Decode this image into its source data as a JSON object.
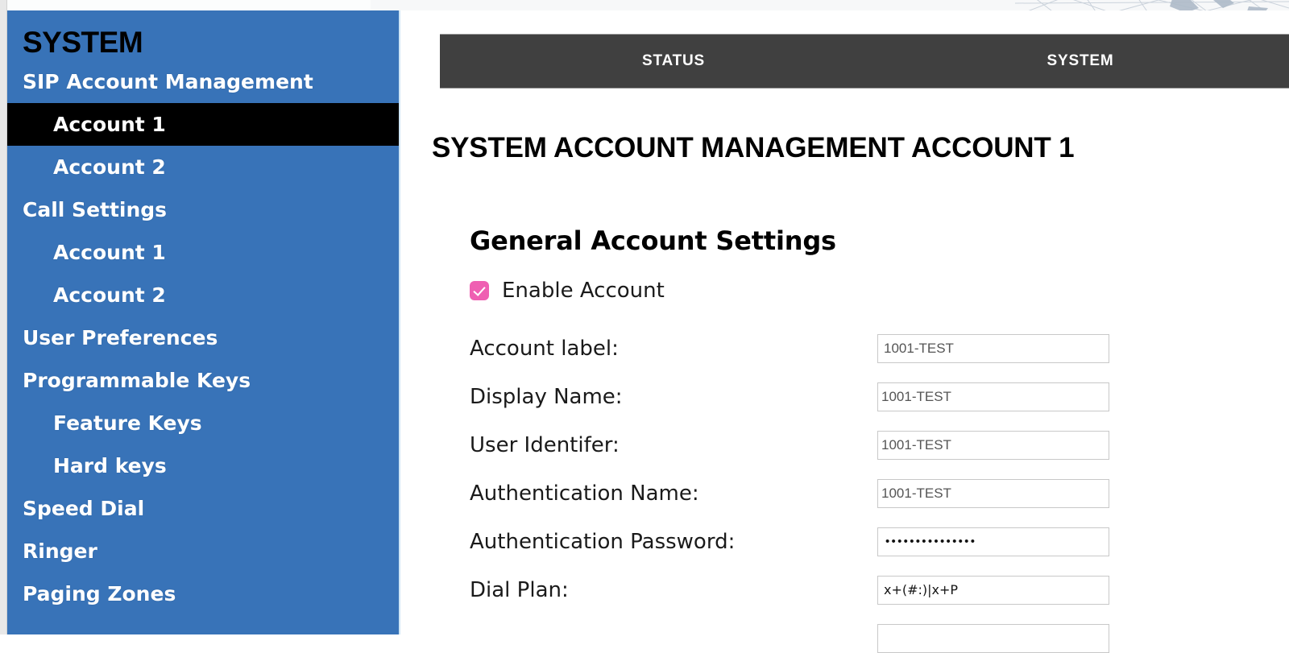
{
  "sidebar": {
    "title": "SYSTEM",
    "items": [
      {
        "label": "SIP Account Management",
        "level": "top",
        "active": false
      },
      {
        "label": "Account 1",
        "level": "sub",
        "active": true
      },
      {
        "label": "Account 2",
        "level": "sub",
        "active": false
      },
      {
        "label": "Call Settings",
        "level": "top",
        "active": false
      },
      {
        "label": "Account 1",
        "level": "sub",
        "active": false
      },
      {
        "label": "Account 2",
        "level": "sub",
        "active": false
      },
      {
        "label": "User Preferences",
        "level": "top",
        "active": false
      },
      {
        "label": "Programmable Keys",
        "level": "top",
        "active": false
      },
      {
        "label": "Feature Keys",
        "level": "sub",
        "active": false
      },
      {
        "label": "Hard keys",
        "level": "sub",
        "active": false
      },
      {
        "label": "Speed Dial",
        "level": "top",
        "active": false
      },
      {
        "label": "Ringer",
        "level": "top",
        "active": false
      },
      {
        "label": "Paging Zones",
        "level": "top",
        "active": false
      }
    ]
  },
  "tabs": [
    {
      "label": "STATUS",
      "active": false
    },
    {
      "label": "SYSTEM",
      "active": true
    }
  ],
  "main": {
    "page_title": "SYSTEM ACCOUNT MANAGEMENT ACCOUNT 1",
    "section_title": "General Account Settings",
    "enable_account": {
      "label": "Enable Account",
      "checked": true
    },
    "fields": [
      {
        "label": "Account label:",
        "value": "1001-TEST",
        "type": "text"
      },
      {
        "label": "Display Name:",
        "value": "1001-TEST",
        "type": "text"
      },
      {
        "label": "User Identifer:",
        "value": "1001-TEST",
        "type": "text"
      },
      {
        "label": "Authentication Name:",
        "value": "1001-TEST",
        "type": "text"
      },
      {
        "label": "Authentication Password:",
        "value": "•••••••••••••••",
        "type": "password"
      },
      {
        "label": "Dial Plan:",
        "value": "x+(#:)|x+P",
        "type": "text"
      },
      {
        "label": "",
        "value": "",
        "type": "text"
      }
    ]
  },
  "colors": {
    "sidebar_blue": "#3873b8",
    "tabbar_dark": "#404040",
    "checkbox_pink": "#ef5fb2",
    "active_item_black": "#000000"
  }
}
